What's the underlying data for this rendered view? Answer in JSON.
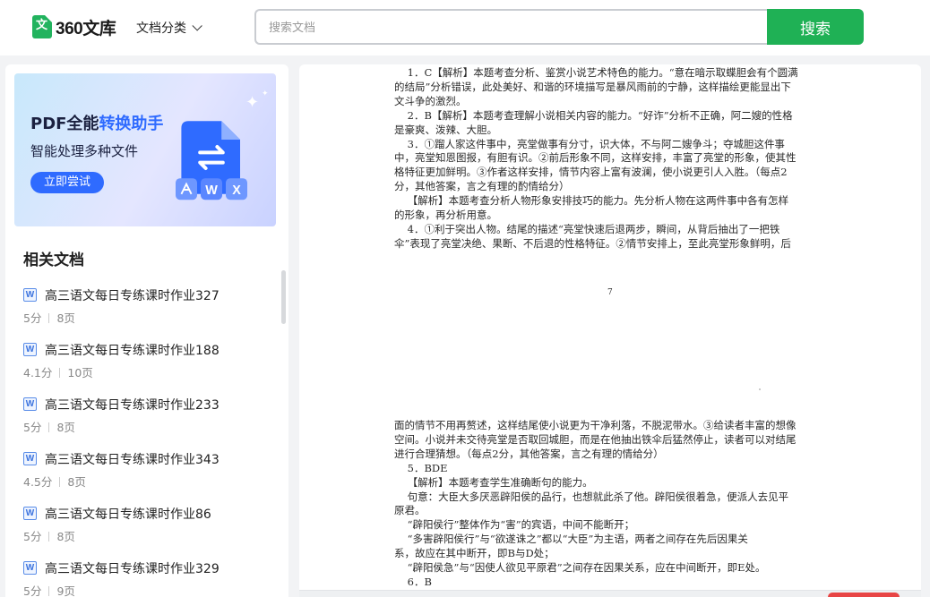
{
  "header": {
    "logo_char": "文",
    "logo_text": "360文库",
    "category_label": "文档分类",
    "search_placeholder": "搜索文档",
    "search_button": "搜索"
  },
  "sidebar": {
    "banner": {
      "title_plain": "PDF全能",
      "title_highlight": "转换助手",
      "subtitle": "智能处理多种文件",
      "button": "立即尝试",
      "badge_w": "W",
      "badge_x": "X"
    },
    "related_title": "相关文档",
    "documents": [
      {
        "icon": "W",
        "title": "高三语文每日专练课时作业327",
        "score": "5分",
        "pages": "8页"
      },
      {
        "icon": "W",
        "title": "高三语文每日专练课时作业188",
        "score": "4.1分",
        "pages": "10页"
      },
      {
        "icon": "W",
        "title": "高三语文每日专练课时作业233",
        "score": "5分",
        "pages": "8页"
      },
      {
        "icon": "W",
        "title": "高三语文每日专练课时作业343",
        "score": "4.5分",
        "pages": "8页"
      },
      {
        "icon": "W",
        "title": "高三语文每日专练课时作业86",
        "score": "5分",
        "pages": "8页"
      },
      {
        "icon": "W",
        "title": "高三语文每日专练课时作业329",
        "score": "5分",
        "pages": "9页"
      }
    ]
  },
  "document": {
    "upper": [
      "    1．C【解析】本题考查分析、鉴赏小说艺术特色的能力。“意在暗示取蝶胆会有个圆满",
      "的结局”分析错误，此处美好、和谐的环境描写是暴风雨前的宁静，这样描绘更能显出下",
      "文斗争的激烈。",
      "    2．B【解析】本题考查理解小说相关内容的能力。“好诈”分析不正确，阿二嫂的性格",
      "是豪爽、泼辣、大胆。",
      "    3．①蹓人家这件事中，亮堂做事有分寸，识大体，不与阿二嫂争斗；夺城胆这件事",
      "中，亮堂知恩图报，有胆有识。②前后形象不同，这样安排，丰富了亮堂的形象，使其性",
      "格特征更加鲜明。③作者这样安排，情节内容上富有波澜，使小说更引人入胜。（每点2",
      "分，其他答案，言之有理的酌情给分）",
      "    【解析】本题考查分析人物形象安排技巧的能力。先分析人物在这两件事中各有怎样",
      "的形象，再分析用意。",
      "    4．①利于突出人物。结尾的描述“亮堂快速后退两步，瞬间，从背后抽出了一把铁",
      "伞”表现了亮堂决绝、果断、不后退的性格特征。②情节安排上，至此亮堂形象鲜明，后"
    ],
    "page_number": "7",
    "lower": [
      "面的情节不用再赘述，这样结尾使小说更为干净利落，不脱泥带水。③给读者丰富的想像",
      "空间。小说并未交待亮堂是否取回城胆，而是在他抽出铁伞后猛然停止，读者可以对结尾",
      "进行合理猜想。（每点2分，其他答案，言之有理的情给分）",
      "    5．BDE",
      "    【解析】本题考查学生准确断句的能力。",
      "    句意：大臣大多厌恶辟阳侯的品行，也想就此杀了他。辟阳侯很着急，便派人去见平",
      "原君。",
      "    “辟阳侯行”整体作为“害”的宾语，中间不能断开；",
      "    “多害辟阳侯行”与“欲遂诛之”都以“大臣”为主语，两者之间存在先后因果关",
      "系，故应在其中断开，即B与D处；",
      "    “辟阳侯急”与“因使人欲见平原君”之间存在因果关系，应在中间断开，即E处。",
      "    6．B"
    ]
  }
}
